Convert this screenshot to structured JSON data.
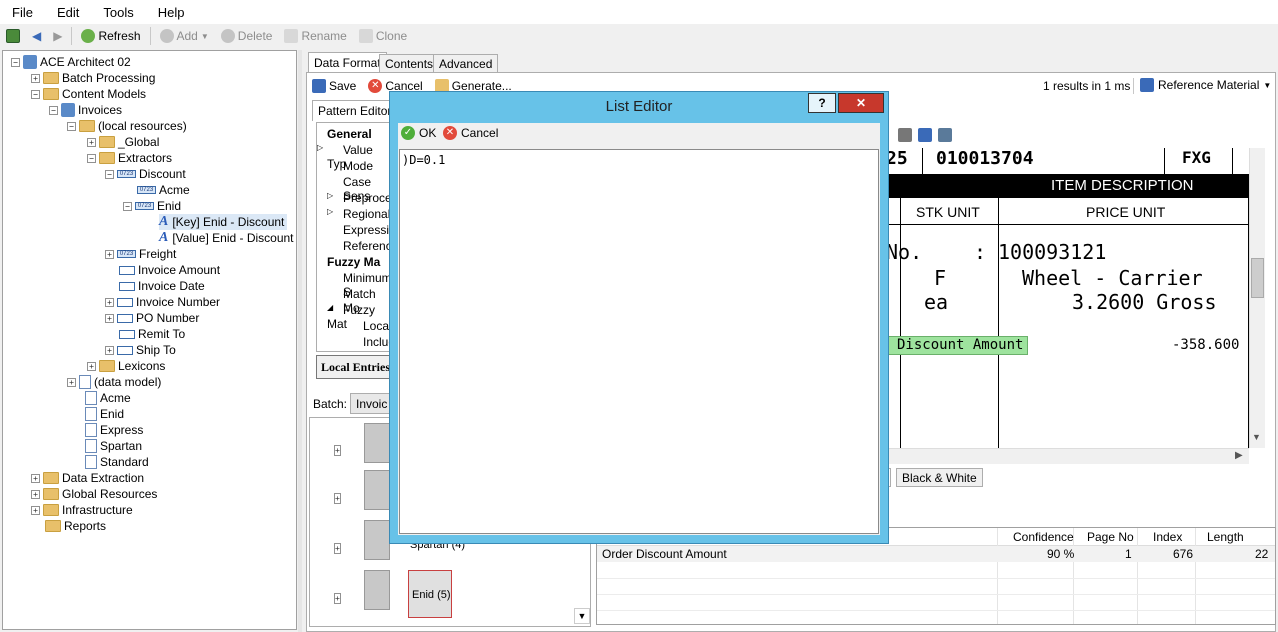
{
  "menu": [
    "File",
    "Edit",
    "Tools",
    "Help"
  ],
  "toolbar": {
    "refresh": "Refresh",
    "add": "Add",
    "delete": "Delete",
    "rename": "Rename",
    "clone": "Clone"
  },
  "tree": {
    "root": "ACE Architect 02",
    "batch_processing": "Batch Processing",
    "content_models": "Content Models",
    "invoices": "Invoices",
    "local_resources": "(local resources)",
    "global": "_Global",
    "extractors": "Extractors",
    "discount": "Discount",
    "acme_fld": "Acme",
    "enid_fld": "Enid",
    "key_enid": "[Key] Enid - Discount",
    "value_enid": "[Value] Enid - Discount",
    "freight": "Freight",
    "invoice_amount": "Invoice Amount",
    "invoice_date": "Invoice Date",
    "invoice_number": "Invoice Number",
    "po_number": "PO Number",
    "remit_to": "Remit To",
    "ship_to": "Ship To",
    "lexicons": "Lexicons",
    "data_model": "(data model)",
    "acme": "Acme",
    "enid": "Enid",
    "express": "Express",
    "spartan": "Spartan",
    "standard": "Standard",
    "data_extraction": "Data Extraction",
    "global_resources": "Global Resources",
    "infrastructure": "Infrastructure",
    "reports": "Reports"
  },
  "tabs": [
    "Data Format",
    "Contents",
    "Advanced"
  ],
  "actions": {
    "save": "Save",
    "cancel": "Cancel",
    "generate": "Generate...",
    "results": "1 results in 1 ms",
    "reference": "Reference Material"
  },
  "subtab": "Pattern Editor",
  "props": {
    "general": "General",
    "value_type": "Value Typ",
    "mode": "Mode",
    "case_sensitive": "Case Sens",
    "preprocess": "Preproces",
    "regional": "Regional",
    "expression": "Expression",
    "reference": "Reference",
    "fuzzy": "Fuzzy Ma",
    "minimum": "Minimum S",
    "match_mode": "Match Mo",
    "fuzzy_match": "Fuzzy Mat",
    "local": "Local",
    "include": "Includ",
    "local_entries": "Local Entries"
  },
  "batch": {
    "label": "Batch:",
    "value": "Invoic",
    "items": [
      "Spartan (4)",
      "Enid (5)"
    ]
  },
  "document": {
    "number_part": "25",
    "invoice_no": "010013704",
    "fxg": "FXG",
    "item_desc": "ITEM DESCRIPTION",
    "stk_unit": "STK UNIT",
    "price_unit": "PRICE UNIT",
    "no_label": "No.",
    "colon": ":",
    "part_no": "100093121",
    "f": "F",
    "wheel": "Wheel - Carrier",
    "ea": "ea",
    "gross": "3.2600 Gross",
    "discount_amount": "Discount Amount",
    "neg_amount": "-358.600"
  },
  "image_mode": "Black & White",
  "grid": {
    "headers": [
      "Confidence",
      "Page No",
      "Index",
      "Length"
    ],
    "row": {
      "name": "Order Discount Amount",
      "confidence": "90 %",
      "page": "1",
      "index": "676",
      "length": "22"
    }
  },
  "dialog": {
    "title": "List Editor",
    "help": "?",
    "close": "✕",
    "ok": "OK",
    "cancel": "Cancel",
    "content": ")D=0.1"
  }
}
